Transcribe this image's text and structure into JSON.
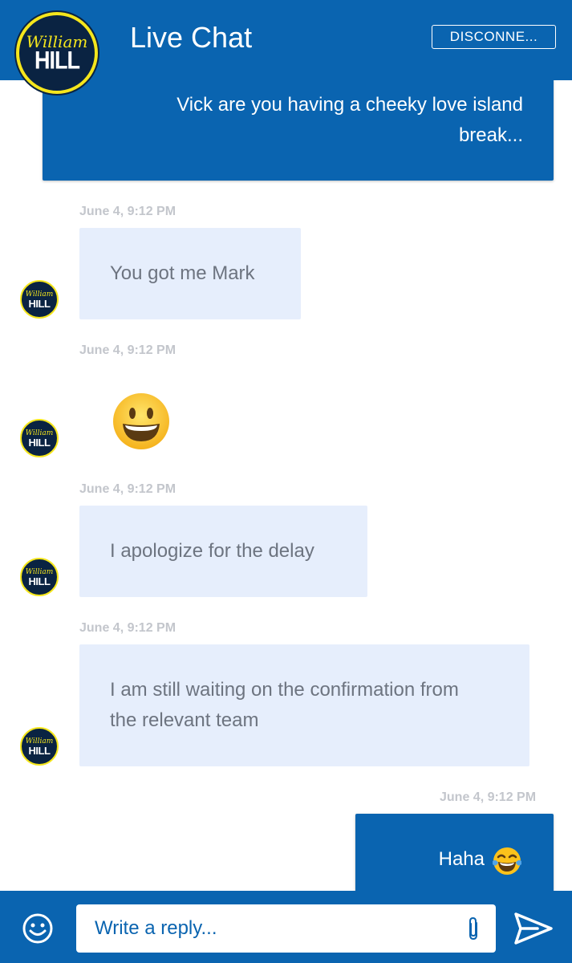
{
  "header": {
    "logo_script": "William",
    "logo_word": "HILL",
    "title": "Live Chat",
    "disconnect_label": "DISCONNE..."
  },
  "messages": [
    {
      "from": "user",
      "text_line1": "Vick are you having a cheeky love island",
      "text_line2": "break..."
    },
    {
      "from": "agent",
      "timestamp": "June 4, 9:12 PM",
      "text": "You got me Mark"
    },
    {
      "from": "agent",
      "timestamp": "June 4, 9:12 PM",
      "emoji": "grinning-face-emoji"
    },
    {
      "from": "agent",
      "timestamp": "June 4, 9:12 PM",
      "text": "I apologize for the delay"
    },
    {
      "from": "agent",
      "timestamp": "June 4, 9:12 PM",
      "text_line1": "I am still waiting on the confirmation from",
      "text_line2": "the relevant team"
    },
    {
      "from": "user",
      "timestamp": "June 4, 9:12 PM",
      "text": "Haha",
      "emoji": "face-with-tears-of-joy-emoji"
    }
  ],
  "avatar": {
    "script": "William",
    "word": "HILL"
  },
  "footer": {
    "reply_placeholder": "Write a reply...",
    "emoji_icon": "smiley-icon",
    "attach_icon": "paperclip-icon",
    "send_icon": "send-icon"
  },
  "colors": {
    "brand_blue": "#0a64b0",
    "agent_bubble": "#e6eefc",
    "logo_navy": "#0a2342",
    "logo_yellow": "#f5e61c"
  }
}
